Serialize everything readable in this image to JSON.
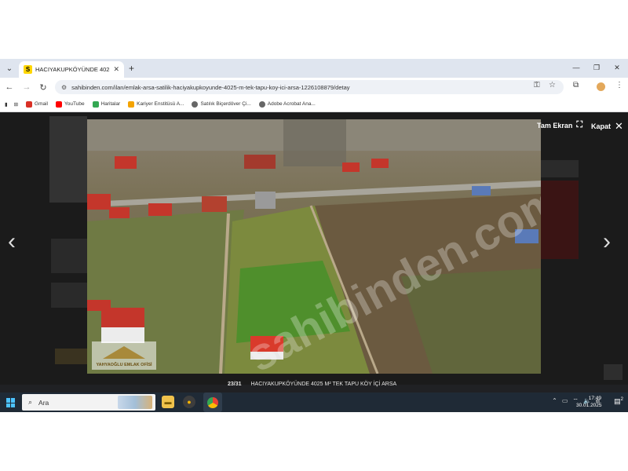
{
  "browser": {
    "tab_title": "HACIYAKUPKÖYÜNDE 4025 M² TEK TA",
    "favicon_letter": "S",
    "address": "sahibinden.com/ilan/emlak-arsa-satilik-haciyakupkoyunde-4025-m-tek-tapu-koy-ici-arsa-1226108879/detay",
    "bookmarks": [
      {
        "label": "Gmail",
        "color": "#d93025"
      },
      {
        "label": "YouTube",
        "color": "#ff0000"
      },
      {
        "label": "Haritalar",
        "color": "#34a853"
      },
      {
        "label": "Kariyer Enstitüsü A...",
        "color": "#f4a300"
      },
      {
        "label": "Satılık Biçerdöver Çi...",
        "color": "#666666"
      },
      {
        "label": "Adobe Acrobat Ana...",
        "color": "#666666"
      }
    ]
  },
  "viewer": {
    "fullscreen_label": "Tam Ekran",
    "close_label": "Kapat",
    "counter": "23/31",
    "caption": "HACIYAKUPKÖYÜNDE 4025 M² TEK TAPU KÖY İÇİ ARSA",
    "watermark": "sahibinden.com",
    "logo_text": "YAHYAOĞLU EMLAK OFİSİ"
  },
  "taskbar": {
    "search_placeholder": "Ara",
    "time": "17:49",
    "date": "30.01.2025",
    "notification_count": "2"
  },
  "colors": {
    "accent_yellow": "#ffd600",
    "taskbar": "#1f2a36"
  }
}
